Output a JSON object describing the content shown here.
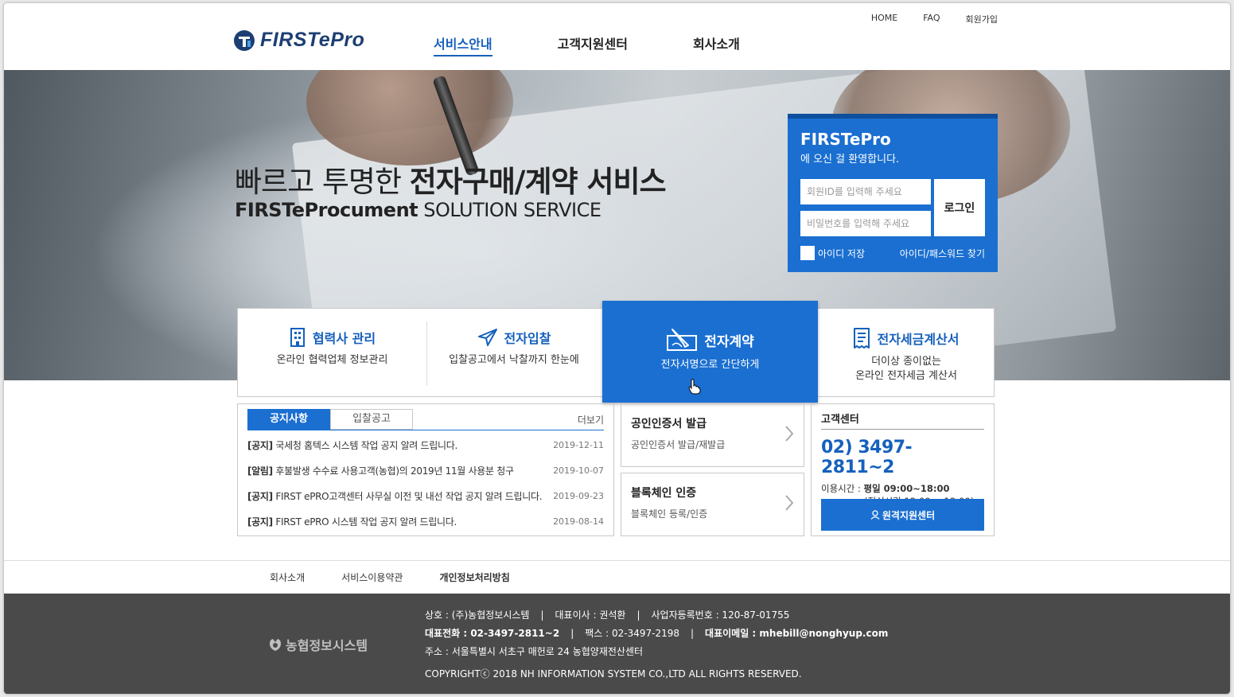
{
  "util_nav": [
    "HOME",
    "FAQ",
    "회원가입"
  ],
  "brand": {
    "logo_text": "FIRSTePro",
    "accent": "#1a6fd1",
    "navy": "#1c3f73"
  },
  "main_nav": [
    {
      "label": "서비스안내",
      "active": true
    },
    {
      "label": "고객지원센터",
      "active": false
    },
    {
      "label": "회사소개",
      "active": false
    }
  ],
  "hero": {
    "title_light": "빠르고 투명한 ",
    "title_bold": "전자구매/계약 서비스",
    "sub_bold": "FIRSTeProcument",
    "sub_light": " SOLUTION SERVICE"
  },
  "login": {
    "brand": "FIRSTePro",
    "welcome": "에 오신 걸 환영합니다.",
    "id_placeholder": "회원ID를 입력해 주세요",
    "pw_placeholder": "비밀번호를 입력해 주세요",
    "button": "로그인",
    "save_id": "아이디 저장",
    "find": "아이디/패스워드 찾기"
  },
  "services": [
    {
      "title": "협력사 관리",
      "desc": "온라인 협력업체 정보관리",
      "icon": "building-icon"
    },
    {
      "title": "전자입찰",
      "desc": "입찰공고에서 낙찰까지 한눈에",
      "icon": "send-icon"
    },
    {
      "title": "전자계약",
      "desc": "전자서명으로 간단하게",
      "icon": "signature-icon"
    },
    {
      "title": "전자세금계산서",
      "desc": "더이상 종이없는",
      "desc2": "온라인 전자세금 계산서",
      "icon": "receipt-icon"
    }
  ],
  "notice": {
    "tabs": [
      "공지사항",
      "입찰공고"
    ],
    "more": "더보기",
    "items": [
      {
        "tag": "[공지]",
        "title": " 국세청 홈텍스 시스템 작업 공지 알려 드립니다.",
        "date": "2019-12-11"
      },
      {
        "tag": "[알림]",
        "title": " 후불발생 수수료 사용고객(농협)의 2019년 11월 사용분 청구",
        "date": "2019-10-07"
      },
      {
        "tag": "[공지]",
        "title": " FIRST ePRO고객센터 사무실 이전 및 내선 작업 공지 알려 드립니다.",
        "date": "2019-09-23"
      },
      {
        "tag": "[공지]",
        "title": " FIRST ePRO 시스템 작업 공지 알려 드립니다.",
        "date": "2019-08-14"
      }
    ]
  },
  "certs": [
    {
      "title": "공인인증서 발급",
      "desc": "공인인증서 발급/재발급"
    },
    {
      "title": "블록체인 인증",
      "desc": "블록체인 등록/인증"
    }
  ],
  "support": {
    "title": "고객센터",
    "phone": "02) 3497-2811~2",
    "hours_label": "이용시간 : ",
    "hours_value": "평일 09:00~18:00",
    "lunch": "(점심시간 12:00 ~ 13:00)",
    "button": "원격지원센터"
  },
  "footer_links": [
    "회사소개",
    "서비스이용약관",
    "개인정보처리방침"
  ],
  "footer": {
    "logo": "농협정보시스템",
    "company": "상호 : (주)농협정보시스템",
    "ceo": "대표이사 : 권석환",
    "biz_no": "사업자등록번호 : 120-87-01755",
    "phone": "대표전화 : 02-3497-2811~2",
    "fax": "팩스 : 02-3497-2198",
    "email": "대표이메일 : mhebill@nonghyup.com",
    "address": "주소 : 서울특별시 서초구 매헌로 24 농협양재전산센터",
    "copyright": "COPYRIGHTⓒ 2018 NH INFORMATION SYSTEM CO.,LTD ALL RIGHTS RESERVED."
  }
}
